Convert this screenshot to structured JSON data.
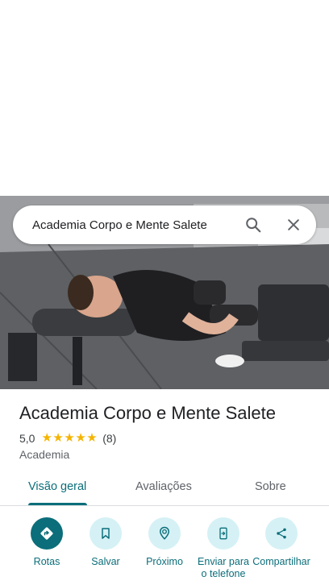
{
  "search": {
    "query": "Academia Corpo e Mente Salete"
  },
  "place": {
    "name": "Academia Corpo e Mente Salete",
    "rating": "5,0",
    "stars": 5,
    "reviews_count": "(8)",
    "category": "Academia"
  },
  "tabs": [
    {
      "label": "Visão geral",
      "active": true
    },
    {
      "label": "Avaliações",
      "active": false
    },
    {
      "label": "Sobre",
      "active": false
    }
  ],
  "actions": [
    {
      "label": "Rotas",
      "icon": "directions-icon",
      "primary": true
    },
    {
      "label": "Salvar",
      "icon": "bookmark-icon",
      "primary": false
    },
    {
      "label": "Próximo",
      "icon": "nearby-icon",
      "primary": false
    },
    {
      "label": "Enviar para o telefone",
      "icon": "send-to-phone-icon",
      "primary": false
    },
    {
      "label": "Compartilhar",
      "icon": "share-icon",
      "primary": false
    }
  ],
  "colors": {
    "accent": "#0b6e7a",
    "accent_light": "#d5f1f5",
    "star": "#f4b400"
  }
}
